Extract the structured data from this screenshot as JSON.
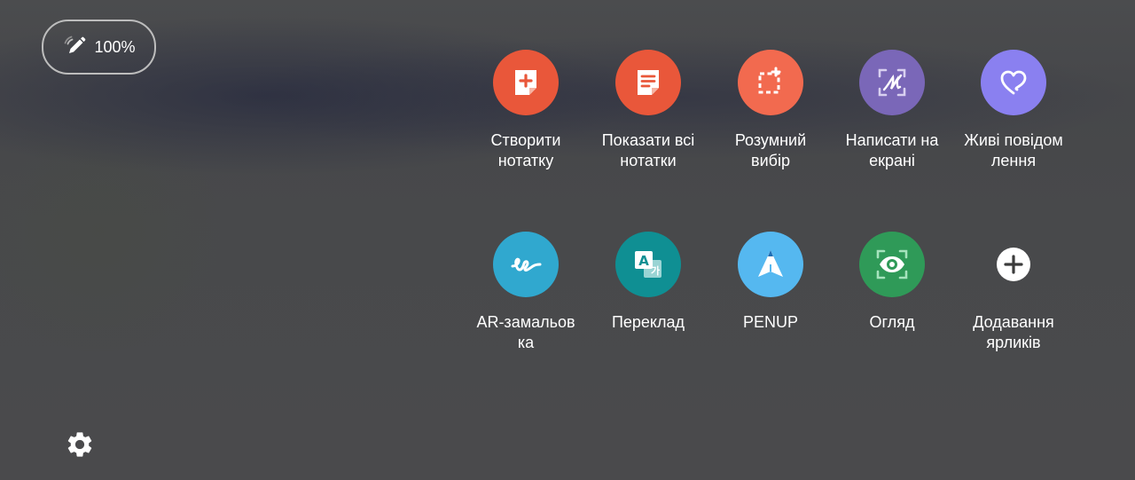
{
  "status": {
    "battery_text": "100%"
  },
  "shortcuts": [
    {
      "label": "Створити\nнотатку",
      "icon": "create-note-icon",
      "color": "#e9573a"
    },
    {
      "label": "Показати всі\nнотатки",
      "icon": "view-all-notes-icon",
      "color": "#e9573a"
    },
    {
      "label": "Розумний\nвибір",
      "icon": "smart-select-icon",
      "color": "#f26a4f"
    },
    {
      "label": "Написати на\nекрані",
      "icon": "screen-write-icon",
      "color": "#7a67b8"
    },
    {
      "label": "Живі повідом\nлення",
      "icon": "live-message-icon",
      "color": "#8a80f0"
    },
    {
      "label": "AR-замальов\nка",
      "icon": "ar-doodle-icon",
      "color": "#30a8cf"
    },
    {
      "label": "Переклад",
      "icon": "translate-icon",
      "color": "#0f8f93"
    },
    {
      "label": "PENUP",
      "icon": "penup-icon",
      "color": "#55b8f0"
    },
    {
      "label": "Огляд",
      "icon": "glance-eye-icon",
      "color": "#2f9a58"
    },
    {
      "label": "Додавання\nярликів",
      "icon": "add-shortcut-icon",
      "color": "#ffffff"
    }
  ],
  "icons": {
    "settings": "gear-icon",
    "pen": "pen-icon"
  }
}
